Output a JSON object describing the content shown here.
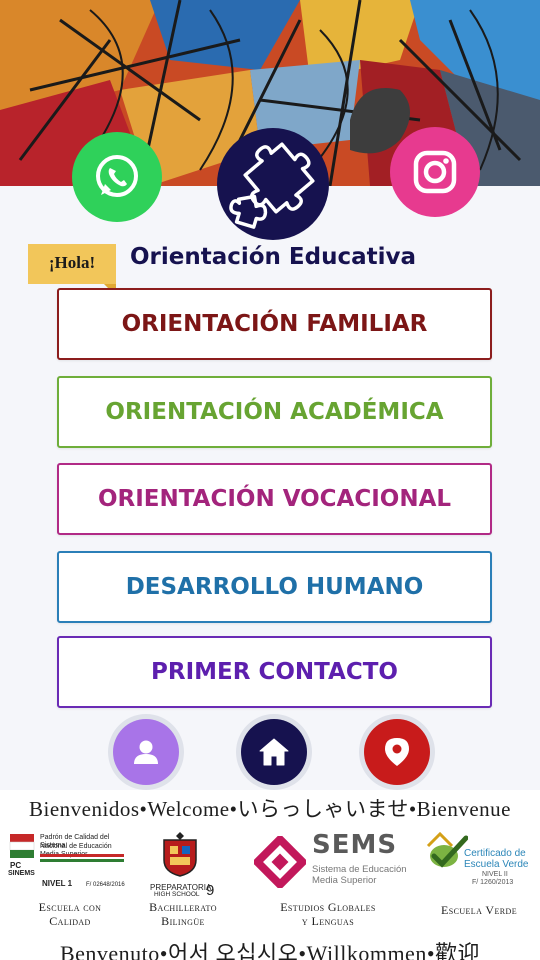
{
  "social": {
    "whatsapp": "whatsapp-icon",
    "instagram": "instagram-icon",
    "logo": "puzzle-icon"
  },
  "greeting": "¡Hola!",
  "title": "Orientación Educativa",
  "menu": [
    {
      "label": "ORIENTACIÓN FAMILIAR",
      "color": "#7c1616"
    },
    {
      "label": "ORIENTACIÓN ACADÉMICA",
      "color": "#67a432"
    },
    {
      "label": "ORIENTACIÓN VOCACIONAL",
      "color": "#a3247c"
    },
    {
      "label": "DESARROLLO HUMANO",
      "color": "#1f70a8"
    },
    {
      "label": "PRIMER CONTACTO",
      "color": "#5d1fae"
    }
  ],
  "nav": [
    {
      "icon": "user-icon",
      "color": "#a874e8"
    },
    {
      "icon": "home-icon",
      "color": "#16124f"
    },
    {
      "icon": "location-pin-icon",
      "color": "#c81b1b"
    }
  ],
  "footer": {
    "welcome_top": "Bienvenidos•Welcome•いらっしゃいませ•Bienvenue",
    "welcome_bottom": "Benvenuto•어서 오십시오•Willkommen•歡迎",
    "badges": {
      "pc": {
        "line1": "Padrón de Calidad del Sistema",
        "line2": "Nacional de Educación Media Superior",
        "abbr1": "PC",
        "abbr2": "SINEMS",
        "nivel": "NIVEL 1",
        "folio": "F/ 02648/2016"
      },
      "prepa": {
        "name": "PREPARATORIA",
        "sub": "HIGH SCHOOL",
        "num": "9"
      },
      "sems": {
        "name": "SEMS",
        "line1": "Sistema de Educación",
        "line2": "Media Superior"
      },
      "cert": {
        "line1": "Certificado de",
        "line2": "Escuela Verde",
        "nivel": "NIVEL II",
        "folio": "F/ 1260/2013"
      }
    },
    "captions": [
      {
        "line1": "Escuela con",
        "line2": "Calidad"
      },
      {
        "line1": "Bachillerato",
        "line2": "Bilingüe"
      },
      {
        "line1": "Estudios Globales",
        "line2": "y Lenguas"
      },
      {
        "line1": "Escuela Verde",
        "line2": ""
      }
    ]
  },
  "colors": {
    "navy": "#16124f",
    "whatsapp": "#2fd15a",
    "instagram": "#e73a8f",
    "greeting_bg": "#f2c65a"
  }
}
